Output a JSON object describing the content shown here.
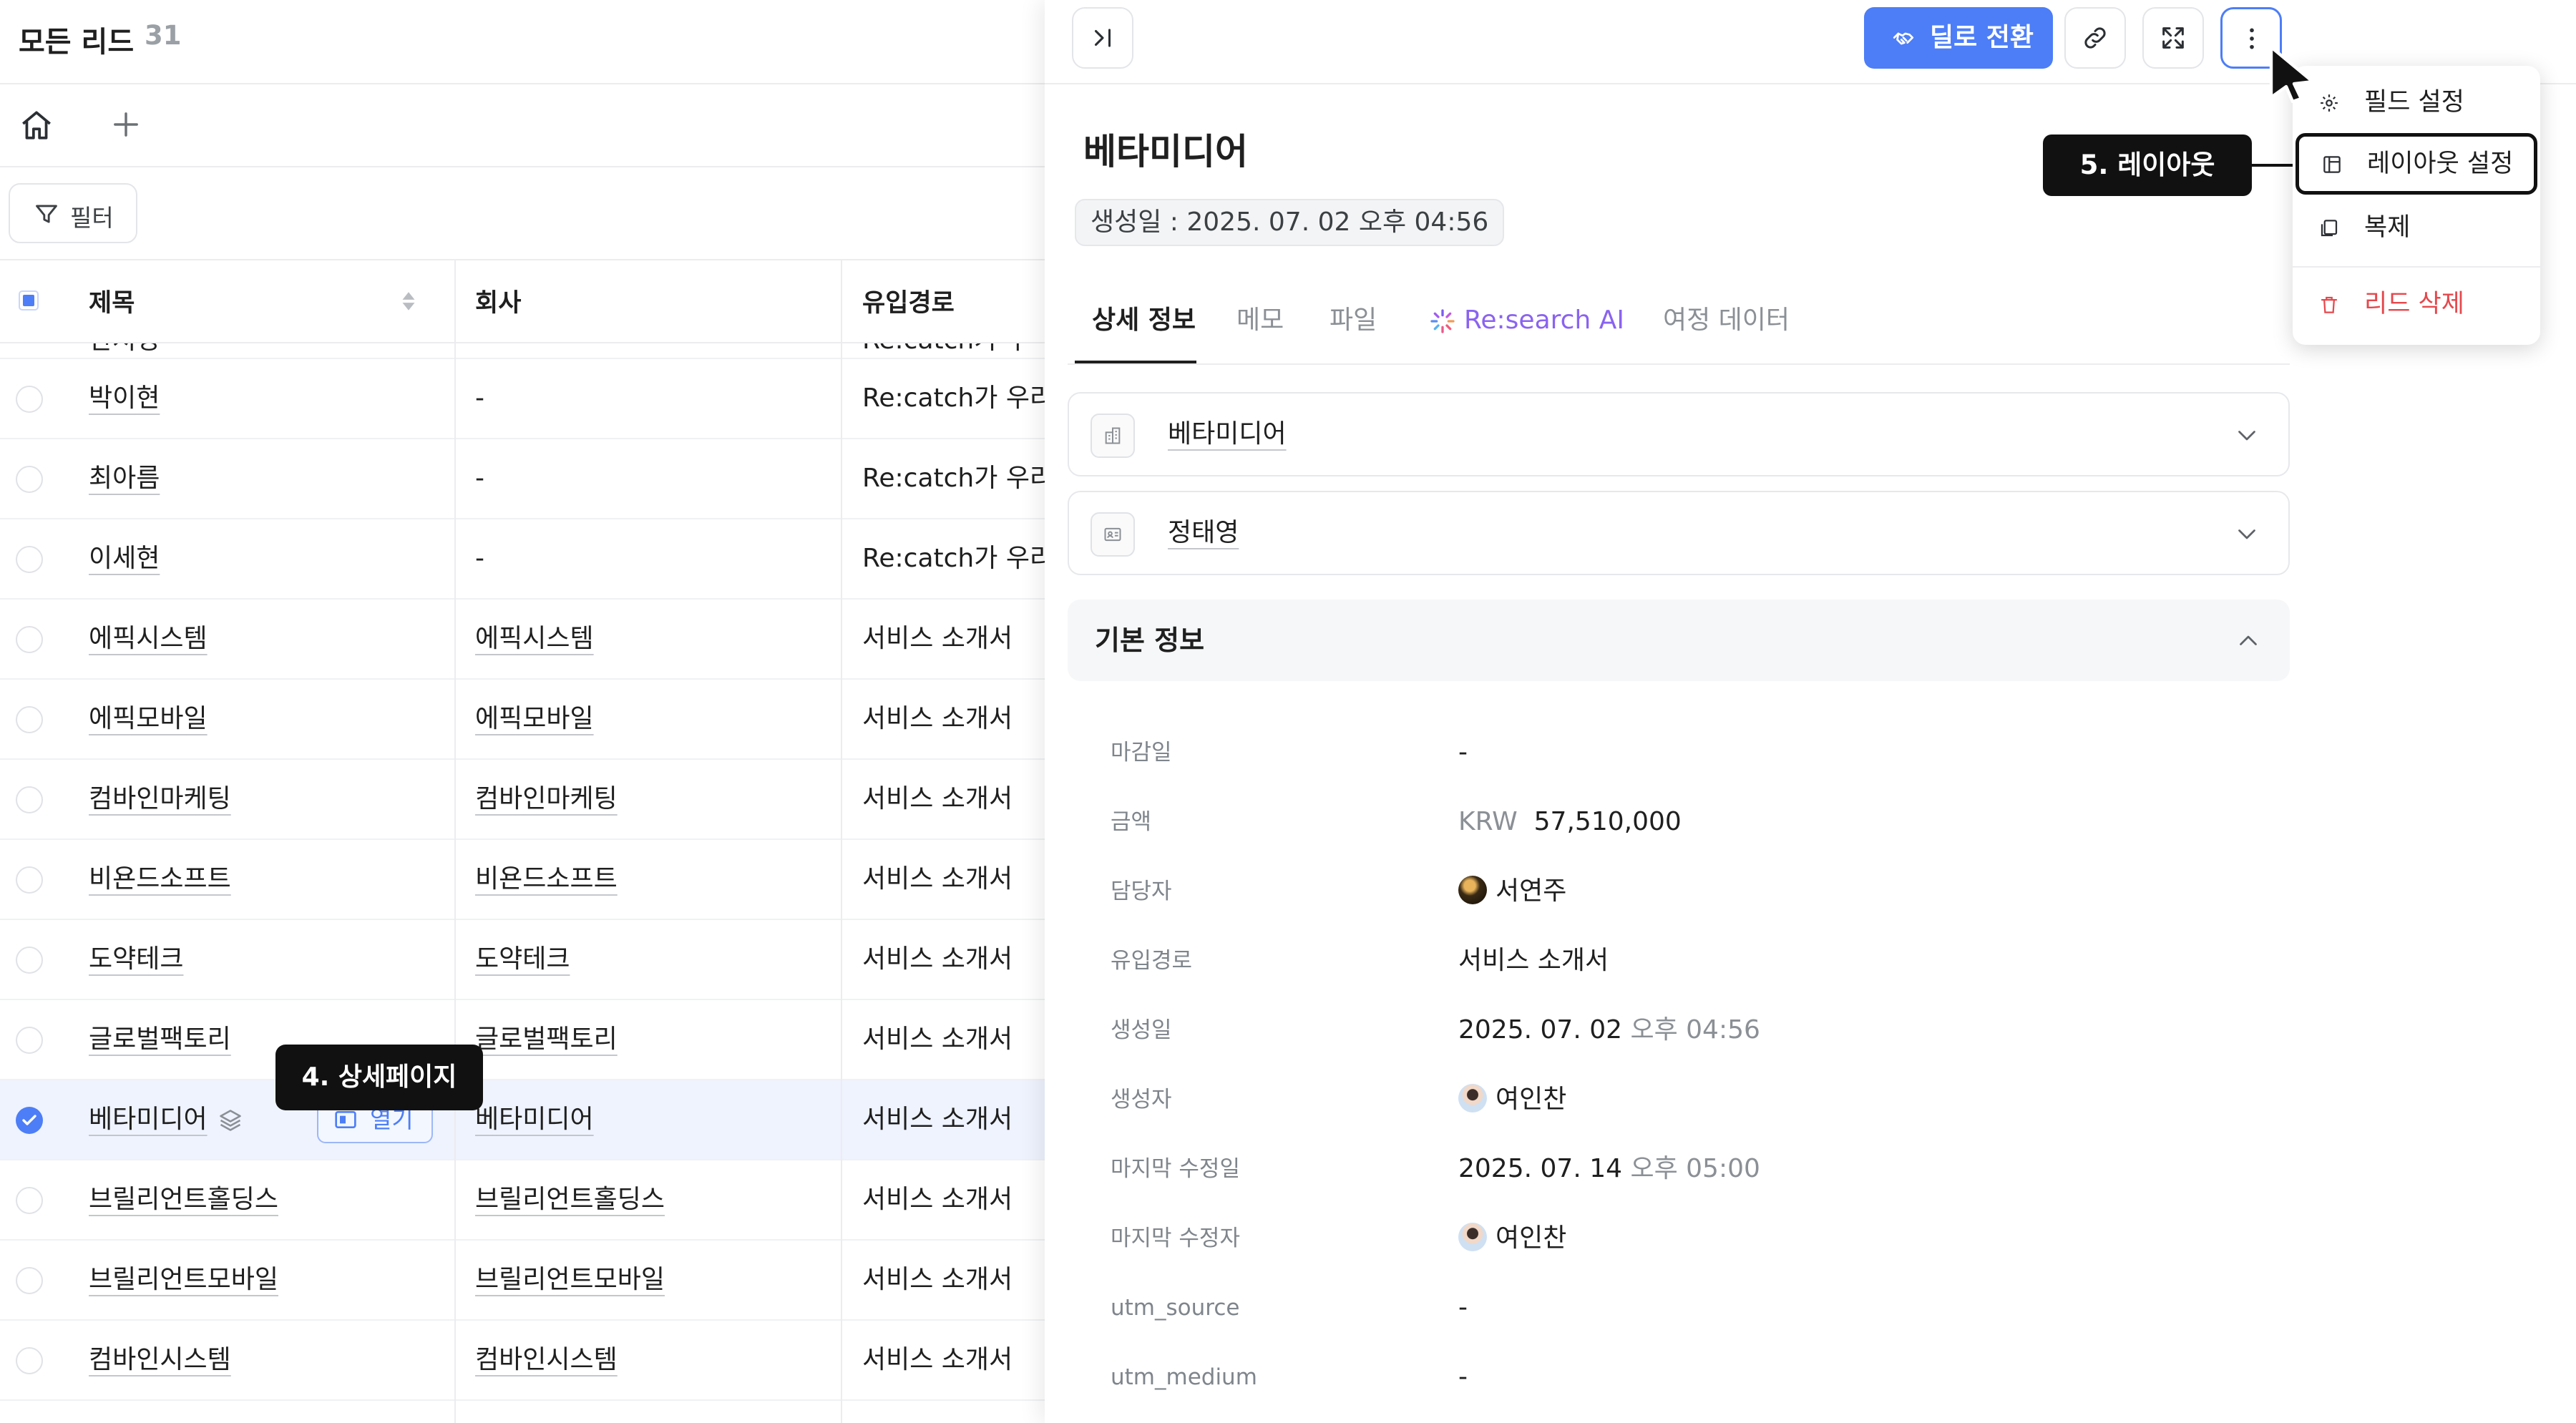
{
  "list": {
    "title": "모든 리드",
    "count": "31",
    "filter_label": "필터",
    "columns": [
      "제목",
      "회사",
      "유입경로"
    ],
    "partial_row": {
      "title": "한서영",
      "source": "Re:catch가 우리"
    },
    "rows": [
      {
        "title": "박이현",
        "company": "-",
        "source": "Re:catch가 우리",
        "selected": false
      },
      {
        "title": "최아름",
        "company": "-",
        "source": "Re:catch가 우리",
        "selected": false
      },
      {
        "title": "이세현",
        "company": "-",
        "source": "Re:catch가 우리",
        "selected": false
      },
      {
        "title": "에픽시스템",
        "company": "에픽시스템",
        "source": "서비스 소개서",
        "selected": false
      },
      {
        "title": "에픽모바일",
        "company": "에픽모바일",
        "source": "서비스 소개서",
        "selected": false
      },
      {
        "title": "컴바인마케팅",
        "company": "컴바인마케팅",
        "source": "서비스 소개서",
        "selected": false
      },
      {
        "title": "비욘드소프트",
        "company": "비욘드소프트",
        "source": "서비스 소개서",
        "selected": false
      },
      {
        "title": "도약테크",
        "company": "도약테크",
        "source": "서비스 소개서",
        "selected": false
      },
      {
        "title": "글로벌팩토리",
        "company": "글로벌팩토리",
        "source": "서비스 소개서",
        "selected": false
      },
      {
        "title": "베타미디어",
        "company": "베타미디어",
        "source": "서비스 소개서",
        "selected": true
      },
      {
        "title": "브릴리언트홀딩스",
        "company": "브릴리언트홀딩스",
        "source": "서비스 소개서",
        "selected": false
      },
      {
        "title": "브릴리언트모바일",
        "company": "브릴리언트모바일",
        "source": "서비스 소개서",
        "selected": false
      },
      {
        "title": "컴바인시스템",
        "company": "컴바인시스템",
        "source": "서비스 소개서",
        "selected": false
      }
    ],
    "open_label": "열기",
    "tooltip_step4": "4. 상세페이지"
  },
  "detail": {
    "convert_button": "딜로 전환",
    "title": "베타미디어",
    "created_chip": "생성일 : 2025. 07. 02 오후 04:56",
    "tabs": [
      "상세 정보",
      "메모",
      "파일",
      "Re:search AI",
      "여정 데이터"
    ],
    "active_tab": "상세 정보",
    "associations": [
      {
        "label": "베타미디어",
        "icon": "company-icon"
      },
      {
        "label": "정태영",
        "icon": "contact-card-icon"
      }
    ],
    "section_title": "기본 정보",
    "fields": [
      {
        "label": "마감일",
        "value": "-"
      },
      {
        "label": "금액",
        "currency": "KRW",
        "value": "57,510,000"
      },
      {
        "label": "담당자",
        "value": "서연주",
        "avatar": "dark"
      },
      {
        "label": "유입경로",
        "value": "서비스 소개서"
      },
      {
        "label": "생성일",
        "value": "2025. 07. 02",
        "suffix": "오후 04:56"
      },
      {
        "label": "생성자",
        "value": "여인찬",
        "avatar": "light"
      },
      {
        "label": "마지막 수정일",
        "value": "2025. 07. 14",
        "suffix": "오후 05:00"
      },
      {
        "label": "마지막 수정자",
        "value": "여인찬",
        "avatar": "light"
      },
      {
        "label": "utm_source",
        "value": "-"
      },
      {
        "label": "utm_medium",
        "value": "-"
      }
    ]
  },
  "menu": {
    "items": [
      "필드 설정",
      "레이아웃 설정",
      "복제",
      "리드 삭제"
    ]
  },
  "tooltip_step5": "5. 레이아웃",
  "colors": {
    "accent": "#4d7ef7",
    "danger": "#e5484d",
    "ai_purple": "#8a63f0",
    "selected_row": "#eef3fe"
  }
}
